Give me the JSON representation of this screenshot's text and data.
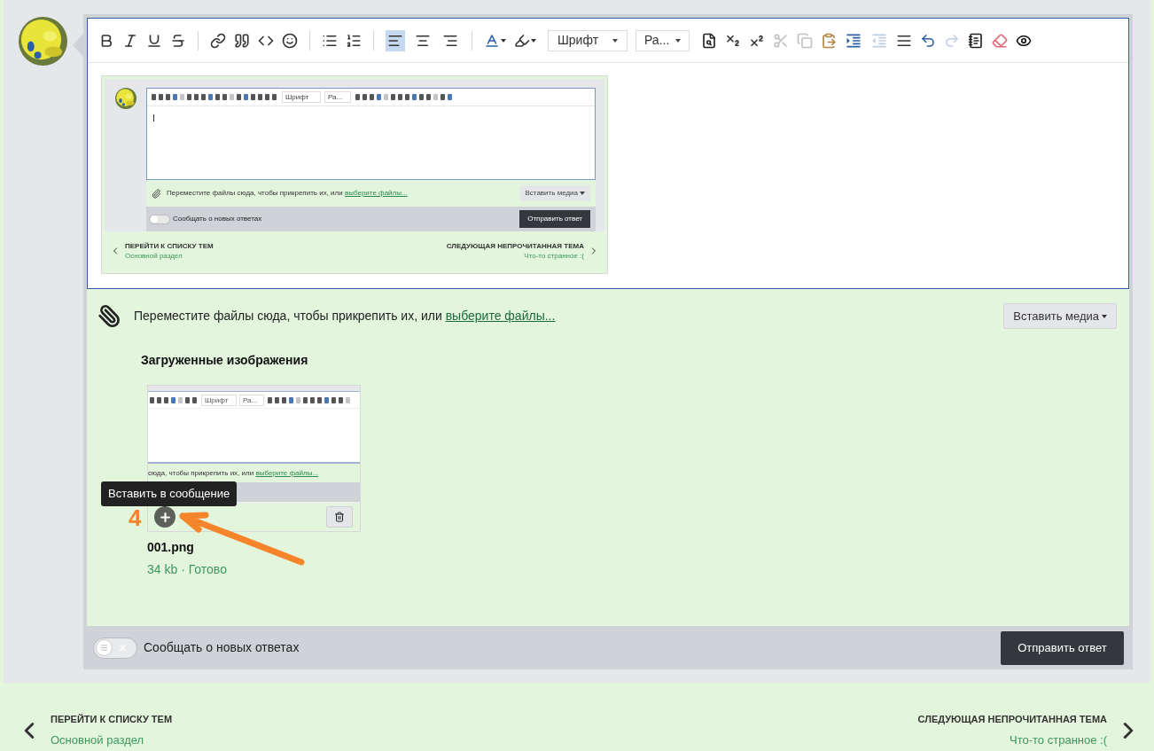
{
  "toolbar": {
    "groups": [
      [
        {
          "kind": "bold"
        },
        {
          "kind": "italic"
        },
        {
          "kind": "underline"
        },
        {
          "kind": "strike"
        }
      ],
      [
        {
          "kind": "link"
        },
        {
          "kind": "quote"
        },
        {
          "kind": "code"
        },
        {
          "kind": "smiley"
        }
      ],
      [
        {
          "kind": "bullets"
        },
        {
          "kind": "numbers"
        }
      ]
    ],
    "alignment": [
      {
        "kind": "left",
        "selected": true
      },
      {
        "kind": "center",
        "selected": false
      },
      {
        "kind": "right",
        "selected": false
      }
    ],
    "color_tools": [
      {
        "kind": "text_color"
      },
      {
        "kind": "highlight"
      }
    ],
    "font_select": "Шрифт",
    "size_select": "Ра...",
    "more_tools": [
      {
        "kind": "preview",
        "disabled": false
      },
      {
        "kind": "subscript",
        "disabled": false
      },
      {
        "kind": "superscript",
        "disabled": false
      },
      {
        "kind": "cut",
        "disabled": true
      },
      {
        "kind": "copy",
        "disabled": true
      },
      {
        "kind": "paste",
        "disabled": false
      },
      {
        "kind": "indent",
        "disabled": false
      },
      {
        "kind": "outdent",
        "disabled": true
      },
      {
        "kind": "justify",
        "disabled": false
      },
      {
        "kind": "undo",
        "disabled": false
      },
      {
        "kind": "redo",
        "disabled": true
      },
      {
        "kind": "template",
        "disabled": false
      },
      {
        "kind": "eraser",
        "disabled": false
      },
      {
        "kind": "eye",
        "disabled": false
      }
    ]
  },
  "embedded_screenshot": {
    "font_select": "Шрифт",
    "size_select": "Ра...",
    "drop_text": "Переместите файлы сюда, чтобы прикрепить их, или",
    "drop_link": "выберите файлы...",
    "insert_media": "Вставить медиа",
    "notify_on": false,
    "notify_label": "Сообщать о новых ответах",
    "submit": "Отправить ответ",
    "nav_prev_title": "ПЕРЕЙТИ К СПИСКУ ТЕМ",
    "nav_prev_sub": "Основной раздел",
    "nav_next_title": "СЛЕДУЮЩАЯ НЕПРОЧИТАННАЯ ТЕМА",
    "nav_next_sub": "Что-то странное :("
  },
  "attachments": {
    "drop_text": "Переместите файлы сюда, чтобы прикрепить их, или",
    "drop_link": "выберите файлы...",
    "insert_media": "Вставить медиа",
    "heading": "Загруженные изображения",
    "files": [
      {
        "name": "001.png",
        "meta": "34 kb · Готово",
        "tooltip": "Вставить в сообщение",
        "annotation": "4",
        "thumbnail": {
          "font_select": "Шрифт",
          "size_select": "Ра...",
          "drop_text": "сюда, чтобы прикрепить их, или",
          "drop_link": "выберите файлы..."
        }
      }
    ]
  },
  "footer": {
    "notify": {
      "label": "Сообщать о новых ответах",
      "on": false
    },
    "submit": "Отправить ответ"
  },
  "navigation": {
    "prev": {
      "title": "ПЕРЕЙТИ К СПИСКУ ТЕМ",
      "subtitle": "Основной раздел"
    },
    "next": {
      "title": "СЛЕДУЮЩАЯ НЕПРОЧИТАННАЯ ТЕМА",
      "subtitle": "Что-то странное :("
    }
  }
}
